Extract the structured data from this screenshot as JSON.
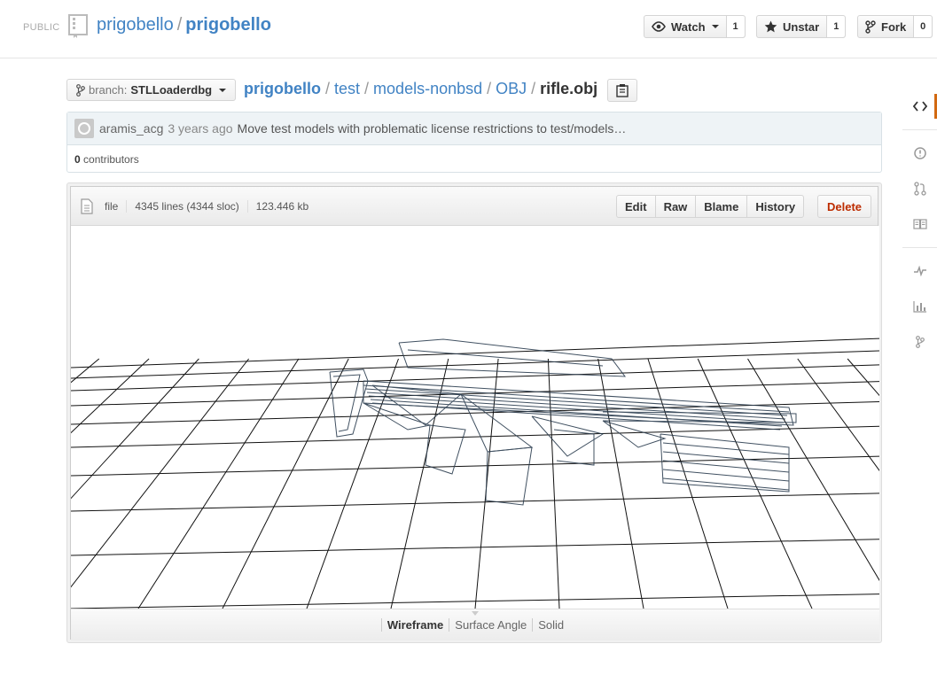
{
  "header": {
    "visibility": "PUBLIC",
    "owner": "prigobello",
    "repo": "prigobello",
    "watch": {
      "label": "Watch",
      "count": "1"
    },
    "unstar": {
      "label": "Unstar",
      "count": "1"
    },
    "fork": {
      "label": "Fork",
      "count": "0"
    }
  },
  "nav": {
    "branch_label": "branch:",
    "branch_name": "STLLoaderdbg",
    "path": [
      "prigobello",
      "test",
      "models-nonbsd",
      "OBJ"
    ],
    "file": "rifle.obj",
    "separator": "/"
  },
  "commit": {
    "author": "aramis_acg",
    "time": "3 years ago",
    "message": "Move test models with problematic license restrictions to test/models…",
    "contributors_count": "0",
    "contributors_label": "contributors"
  },
  "file": {
    "type": "file",
    "lines": "4345 lines (4344 sloc)",
    "size": "123.446 kb",
    "buttons": {
      "edit": "Edit",
      "raw": "Raw",
      "blame": "Blame",
      "history": "History",
      "delete": "Delete"
    }
  },
  "viewer": {
    "modes": [
      "Wireframe",
      "Surface Angle",
      "Solid"
    ],
    "active_mode": "Wireframe"
  },
  "colors": {
    "link": "#4183c4",
    "accent": "#d26911",
    "delete": "#bd2c00",
    "wire": "#2c3e50"
  },
  "sidebar_icons": [
    "code-icon",
    "issues-icon",
    "pull-requests-icon",
    "wiki-icon",
    "pulse-icon",
    "graphs-icon",
    "network-icon"
  ]
}
